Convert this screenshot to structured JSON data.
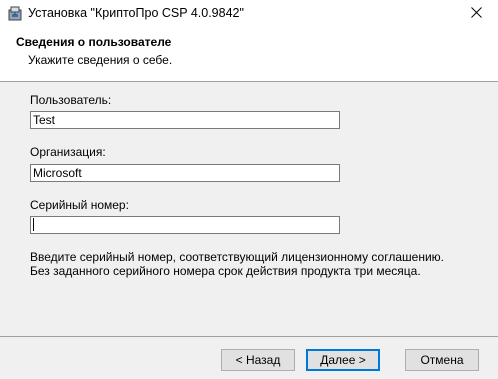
{
  "window": {
    "title": "Установка \"КриптоПро CSP 4.0.9842\"",
    "app_icon": "installer-icon",
    "close_icon": "close-icon"
  },
  "header": {
    "title": "Сведения о пользователе",
    "subtitle": "Укажите сведения о себе."
  },
  "form": {
    "user": {
      "label": "Пользователь:",
      "value": "Test"
    },
    "organization": {
      "label": "Организация:",
      "value": "Microsoft"
    },
    "serial": {
      "label": "Серийный номер:",
      "value": ""
    }
  },
  "info": {
    "line1": "Введите серийный номер, соответствующий лицензионному соглашению.",
    "line2": "Без заданного серийного номера срок действия продукта три месяца."
  },
  "buttons": {
    "back": "< Назад",
    "next": "Далее >",
    "cancel": "Отмена"
  },
  "colors": {
    "default_button_border": "#0078d7",
    "dialog_background": "#f0f0f0",
    "banner_background": "#ffffff"
  }
}
